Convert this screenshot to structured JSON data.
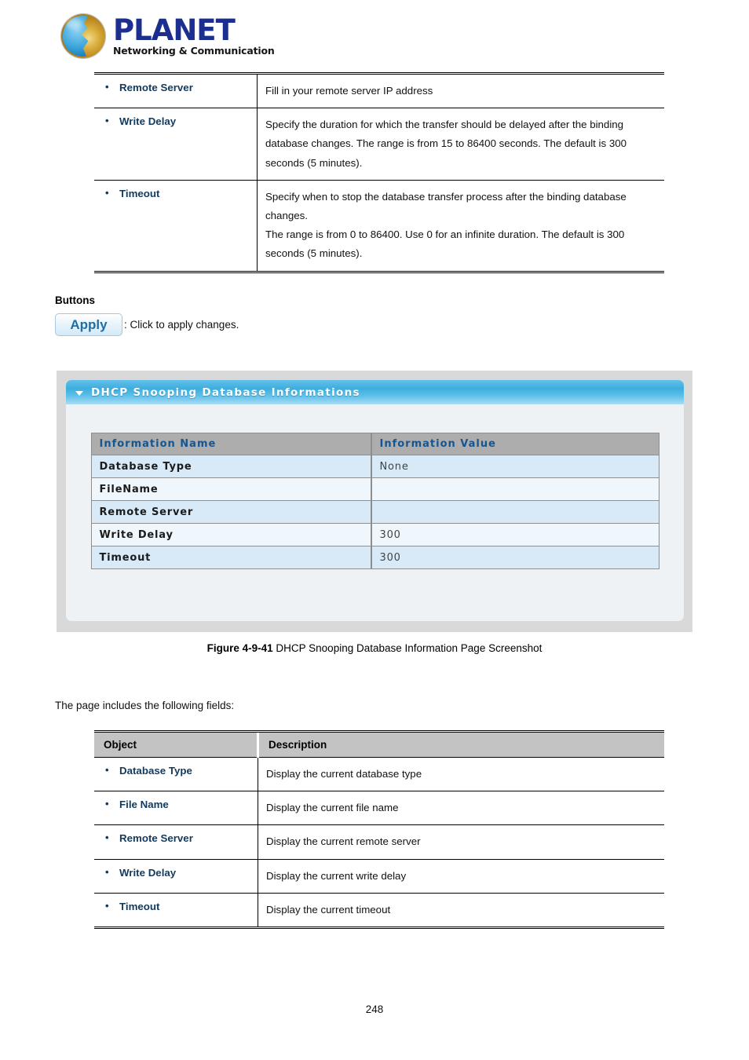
{
  "brand": {
    "name": "PLANET",
    "tagline": "Networking & Communication"
  },
  "top_table": {
    "rows": [
      {
        "object": "Remote Server",
        "description": "Fill in your remote server IP address"
      },
      {
        "object": "Write Delay",
        "description": "Specify the duration for which the transfer should be delayed after the binding database changes. The range is from 15 to 86400 seconds. The default is 300 seconds (5 minutes)."
      },
      {
        "object": "Timeout",
        "description": "Specify when to stop the database transfer process after the binding database changes.\nThe range is from 0 to 86400. Use 0 for an infinite duration. The default is 300 seconds (5 minutes)."
      }
    ]
  },
  "buttons_section": {
    "heading": "Buttons",
    "apply_label": "Apply",
    "apply_caption": ": Click to apply changes."
  },
  "figure": {
    "panel_title": "DHCP Snooping Database Informations",
    "caret_icon": "triangle-down-icon",
    "table": {
      "headers": [
        "Information Name",
        "Information Value"
      ],
      "rows": [
        {
          "name": "Database Type",
          "value": "None"
        },
        {
          "name": "FileName",
          "value": ""
        },
        {
          "name": "Remote Server",
          "value": ""
        },
        {
          "name": "Write Delay",
          "value": "300"
        },
        {
          "name": "Timeout",
          "value": "300"
        }
      ]
    },
    "caption_label": "Figure 4-9-41",
    "caption_text": " DHCP Snooping Database Information Page Screenshot"
  },
  "intro_line": "The page includes the following fields:",
  "bottom_table": {
    "headers": [
      "Object",
      "Description"
    ],
    "rows": [
      {
        "object": "Database Type",
        "description": "Display the current database type"
      },
      {
        "object": "File Name",
        "description": "Display the current file name"
      },
      {
        "object": "Remote Server",
        "description": "Display the current remote server"
      },
      {
        "object": "Write Delay",
        "description": "Display the current write delay"
      },
      {
        "object": "Timeout",
        "description": "Display the current timeout"
      }
    ]
  },
  "page_number": "248",
  "colors": {
    "brand_blue": "#1d2f8e",
    "label_blue": "#123a5e",
    "panel_header_blue": "#3daede",
    "table_header_gray": "#adadad",
    "row_alt_blue": "#d8eaf8",
    "row_alt_light": "#eff7fd",
    "doc_header_gray": "#c3c3c3"
  }
}
